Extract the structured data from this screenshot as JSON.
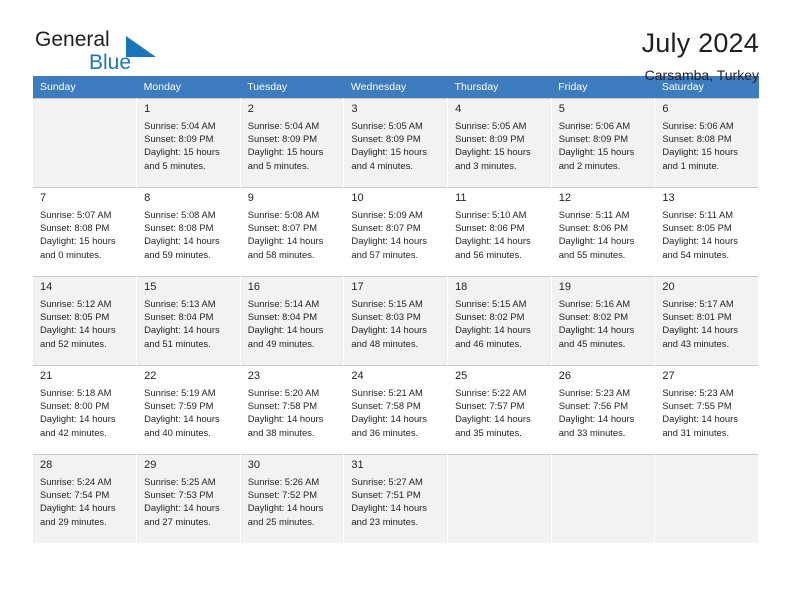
{
  "brand": {
    "name_part1": "General",
    "name_part2": "Blue",
    "accent_color": "#1b75bc"
  },
  "header": {
    "title": "July 2024",
    "subtitle": "Carsamba, Turkey"
  },
  "calendar": {
    "header_color": "#3d7cbf",
    "weekdays": [
      "Sunday",
      "Monday",
      "Tuesday",
      "Wednesday",
      "Thursday",
      "Friday",
      "Saturday"
    ],
    "weeks": [
      [
        {
          "day": "",
          "sunrise": "",
          "sunset": "",
          "daylight_line1": "",
          "daylight_line2": ""
        },
        {
          "day": "1",
          "sunrise": "Sunrise: 5:04 AM",
          "sunset": "Sunset: 8:09 PM",
          "daylight_line1": "Daylight: 15 hours",
          "daylight_line2": "and 5 minutes."
        },
        {
          "day": "2",
          "sunrise": "Sunrise: 5:04 AM",
          "sunset": "Sunset: 8:09 PM",
          "daylight_line1": "Daylight: 15 hours",
          "daylight_line2": "and 5 minutes."
        },
        {
          "day": "3",
          "sunrise": "Sunrise: 5:05 AM",
          "sunset": "Sunset: 8:09 PM",
          "daylight_line1": "Daylight: 15 hours",
          "daylight_line2": "and 4 minutes."
        },
        {
          "day": "4",
          "sunrise": "Sunrise: 5:05 AM",
          "sunset": "Sunset: 8:09 PM",
          "daylight_line1": "Daylight: 15 hours",
          "daylight_line2": "and 3 minutes."
        },
        {
          "day": "5",
          "sunrise": "Sunrise: 5:06 AM",
          "sunset": "Sunset: 8:09 PM",
          "daylight_line1": "Daylight: 15 hours",
          "daylight_line2": "and 2 minutes."
        },
        {
          "day": "6",
          "sunrise": "Sunrise: 5:06 AM",
          "sunset": "Sunset: 8:08 PM",
          "daylight_line1": "Daylight: 15 hours",
          "daylight_line2": "and 1 minute."
        }
      ],
      [
        {
          "day": "7",
          "sunrise": "Sunrise: 5:07 AM",
          "sunset": "Sunset: 8:08 PM",
          "daylight_line1": "Daylight: 15 hours",
          "daylight_line2": "and 0 minutes."
        },
        {
          "day": "8",
          "sunrise": "Sunrise: 5:08 AM",
          "sunset": "Sunset: 8:08 PM",
          "daylight_line1": "Daylight: 14 hours",
          "daylight_line2": "and 59 minutes."
        },
        {
          "day": "9",
          "sunrise": "Sunrise: 5:08 AM",
          "sunset": "Sunset: 8:07 PM",
          "daylight_line1": "Daylight: 14 hours",
          "daylight_line2": "and 58 minutes."
        },
        {
          "day": "10",
          "sunrise": "Sunrise: 5:09 AM",
          "sunset": "Sunset: 8:07 PM",
          "daylight_line1": "Daylight: 14 hours",
          "daylight_line2": "and 57 minutes."
        },
        {
          "day": "11",
          "sunrise": "Sunrise: 5:10 AM",
          "sunset": "Sunset: 8:06 PM",
          "daylight_line1": "Daylight: 14 hours",
          "daylight_line2": "and 56 minutes."
        },
        {
          "day": "12",
          "sunrise": "Sunrise: 5:11 AM",
          "sunset": "Sunset: 8:06 PM",
          "daylight_line1": "Daylight: 14 hours",
          "daylight_line2": "and 55 minutes."
        },
        {
          "day": "13",
          "sunrise": "Sunrise: 5:11 AM",
          "sunset": "Sunset: 8:05 PM",
          "daylight_line1": "Daylight: 14 hours",
          "daylight_line2": "and 54 minutes."
        }
      ],
      [
        {
          "day": "14",
          "sunrise": "Sunrise: 5:12 AM",
          "sunset": "Sunset: 8:05 PM",
          "daylight_line1": "Daylight: 14 hours",
          "daylight_line2": "and 52 minutes."
        },
        {
          "day": "15",
          "sunrise": "Sunrise: 5:13 AM",
          "sunset": "Sunset: 8:04 PM",
          "daylight_line1": "Daylight: 14 hours",
          "daylight_line2": "and 51 minutes."
        },
        {
          "day": "16",
          "sunrise": "Sunrise: 5:14 AM",
          "sunset": "Sunset: 8:04 PM",
          "daylight_line1": "Daylight: 14 hours",
          "daylight_line2": "and 49 minutes."
        },
        {
          "day": "17",
          "sunrise": "Sunrise: 5:15 AM",
          "sunset": "Sunset: 8:03 PM",
          "daylight_line1": "Daylight: 14 hours",
          "daylight_line2": "and 48 minutes."
        },
        {
          "day": "18",
          "sunrise": "Sunrise: 5:15 AM",
          "sunset": "Sunset: 8:02 PM",
          "daylight_line1": "Daylight: 14 hours",
          "daylight_line2": "and 46 minutes."
        },
        {
          "day": "19",
          "sunrise": "Sunrise: 5:16 AM",
          "sunset": "Sunset: 8:02 PM",
          "daylight_line1": "Daylight: 14 hours",
          "daylight_line2": "and 45 minutes."
        },
        {
          "day": "20",
          "sunrise": "Sunrise: 5:17 AM",
          "sunset": "Sunset: 8:01 PM",
          "daylight_line1": "Daylight: 14 hours",
          "daylight_line2": "and 43 minutes."
        }
      ],
      [
        {
          "day": "21",
          "sunrise": "Sunrise: 5:18 AM",
          "sunset": "Sunset: 8:00 PM",
          "daylight_line1": "Daylight: 14 hours",
          "daylight_line2": "and 42 minutes."
        },
        {
          "day": "22",
          "sunrise": "Sunrise: 5:19 AM",
          "sunset": "Sunset: 7:59 PM",
          "daylight_line1": "Daylight: 14 hours",
          "daylight_line2": "and 40 minutes."
        },
        {
          "day": "23",
          "sunrise": "Sunrise: 5:20 AM",
          "sunset": "Sunset: 7:58 PM",
          "daylight_line1": "Daylight: 14 hours",
          "daylight_line2": "and 38 minutes."
        },
        {
          "day": "24",
          "sunrise": "Sunrise: 5:21 AM",
          "sunset": "Sunset: 7:58 PM",
          "daylight_line1": "Daylight: 14 hours",
          "daylight_line2": "and 36 minutes."
        },
        {
          "day": "25",
          "sunrise": "Sunrise: 5:22 AM",
          "sunset": "Sunset: 7:57 PM",
          "daylight_line1": "Daylight: 14 hours",
          "daylight_line2": "and 35 minutes."
        },
        {
          "day": "26",
          "sunrise": "Sunrise: 5:23 AM",
          "sunset": "Sunset: 7:56 PM",
          "daylight_line1": "Daylight: 14 hours",
          "daylight_line2": "and 33 minutes."
        },
        {
          "day": "27",
          "sunrise": "Sunrise: 5:23 AM",
          "sunset": "Sunset: 7:55 PM",
          "daylight_line1": "Daylight: 14 hours",
          "daylight_line2": "and 31 minutes."
        }
      ],
      [
        {
          "day": "28",
          "sunrise": "Sunrise: 5:24 AM",
          "sunset": "Sunset: 7:54 PM",
          "daylight_line1": "Daylight: 14 hours",
          "daylight_line2": "and 29 minutes."
        },
        {
          "day": "29",
          "sunrise": "Sunrise: 5:25 AM",
          "sunset": "Sunset: 7:53 PM",
          "daylight_line1": "Daylight: 14 hours",
          "daylight_line2": "and 27 minutes."
        },
        {
          "day": "30",
          "sunrise": "Sunrise: 5:26 AM",
          "sunset": "Sunset: 7:52 PM",
          "daylight_line1": "Daylight: 14 hours",
          "daylight_line2": "and 25 minutes."
        },
        {
          "day": "31",
          "sunrise": "Sunrise: 5:27 AM",
          "sunset": "Sunset: 7:51 PM",
          "daylight_line1": "Daylight: 14 hours",
          "daylight_line2": "and 23 minutes."
        },
        {
          "day": "",
          "sunrise": "",
          "sunset": "",
          "daylight_line1": "",
          "daylight_line2": ""
        },
        {
          "day": "",
          "sunrise": "",
          "sunset": "",
          "daylight_line1": "",
          "daylight_line2": ""
        },
        {
          "day": "",
          "sunrise": "",
          "sunset": "",
          "daylight_line1": "",
          "daylight_line2": ""
        }
      ]
    ]
  }
}
